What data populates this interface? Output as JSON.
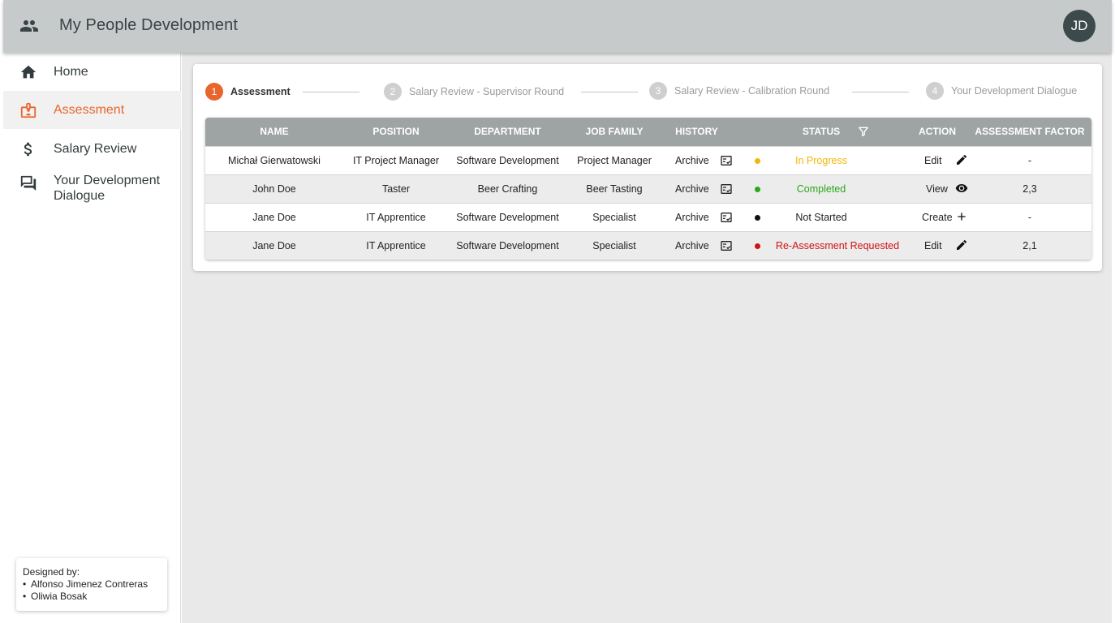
{
  "app": {
    "title": "My People Development",
    "avatar_initials": "JD"
  },
  "sidebar": {
    "items": [
      {
        "label": "Home",
        "icon": "home-icon",
        "active": false
      },
      {
        "label": "Assessment",
        "icon": "badge-icon",
        "active": true
      },
      {
        "label": "Salary Review",
        "icon": "dollar-icon",
        "active": false
      },
      {
        "label": "Your Development Dialogue",
        "icon": "forum-icon",
        "active": false
      }
    ],
    "credits": {
      "heading": "Designed by:",
      "names": [
        "Alfonso Jimenez Contreras",
        "Oliwia Bosak"
      ]
    }
  },
  "stepper": {
    "steps": [
      {
        "number": "1",
        "label": "Assessment",
        "active": true
      },
      {
        "number": "2",
        "label": "Salary Review - Supervisor Round",
        "active": false
      },
      {
        "number": "3",
        "label": "Salary Review - Calibration Round",
        "active": false
      },
      {
        "number": "4",
        "label": "Your Development Dialogue",
        "active": false
      }
    ]
  },
  "table": {
    "headers": {
      "name": "NAME",
      "position": "POSITION",
      "department": "DEPARTMENT",
      "job_family": "JOB FAMILY",
      "history": "HISTORY",
      "status": "STATUS",
      "action": "ACTION",
      "factor": "ASSESSMENT FACTOR"
    },
    "rows": [
      {
        "name": "Michał Gierwatowski",
        "position": "IT Project Manager",
        "department": "Software Development",
        "job_family": "Project Manager",
        "history": "Archive",
        "status": "In Progress",
        "status_color": "#f2b705",
        "action": "Edit",
        "action_icon": "pencil-icon",
        "factor": "-"
      },
      {
        "name": "John Doe",
        "position": "Taster",
        "department": "Beer Crafting",
        "job_family": "Beer Tasting",
        "history": "Archive",
        "status": "Completed",
        "status_color": "#2aa81a",
        "action": "View",
        "action_icon": "eye-icon",
        "factor": "2,3"
      },
      {
        "name": "Jane Doe",
        "position": "IT Apprentice",
        "department": "Software Development",
        "job_family": "Specialist",
        "history": "Archive",
        "status": "Not Started",
        "status_color": "#111111",
        "action": "Create",
        "action_icon": "plus-icon",
        "factor": "-"
      },
      {
        "name": "Jane Doe",
        "position": "IT Apprentice",
        "department": "Software Development",
        "job_family": "Specialist",
        "history": "Archive",
        "status": "Re-Assessment Requested",
        "status_color": "#d01212",
        "action": "Edit",
        "action_icon": "pencil-icon",
        "factor": "2,1"
      }
    ]
  },
  "colors": {
    "accent": "#e8662d",
    "appbar": "#c6cacb",
    "table_header": "#9ea3a4",
    "avatar": "#3c4a4c"
  }
}
